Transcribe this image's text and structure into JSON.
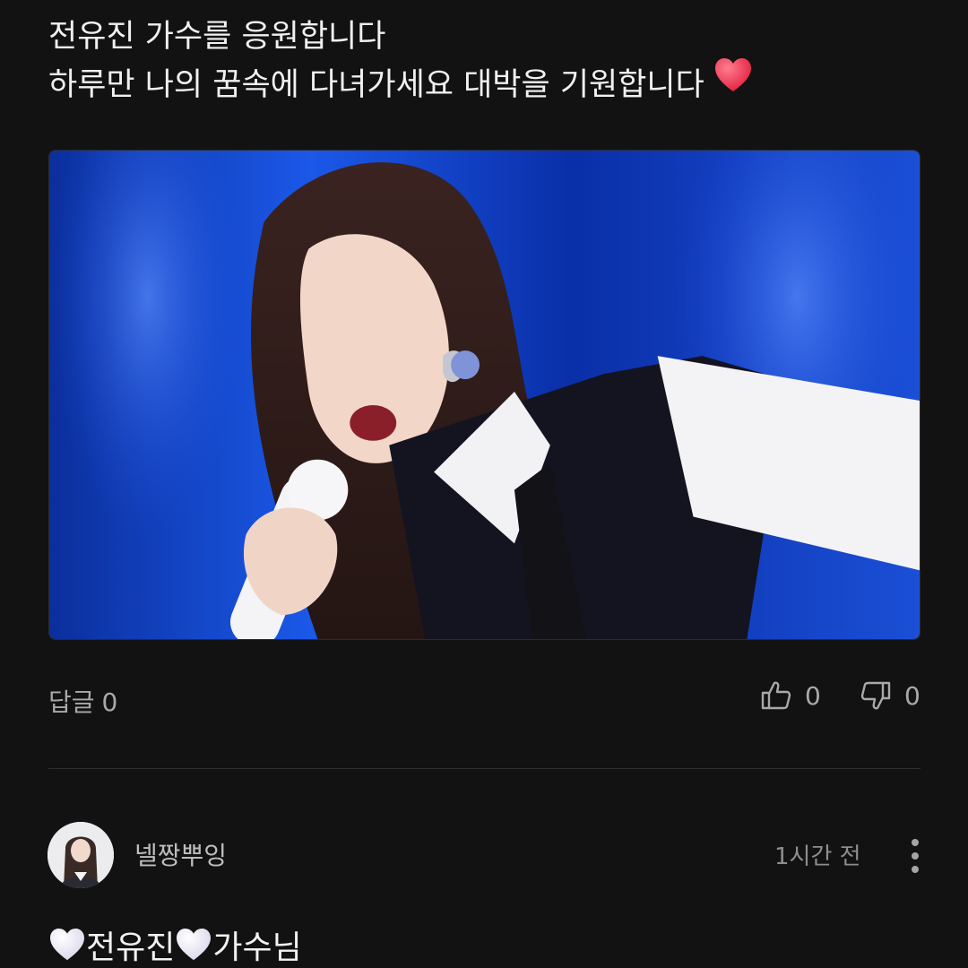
{
  "post": {
    "line1": "전유진 가수를 응원합니다",
    "line2": "하루만 나의 꿈속에 다녀가세요 대박을 기원합니다",
    "heart_color": "#f0304f"
  },
  "actions": {
    "reply_label": "답글",
    "reply_count": "0",
    "like_count": "0",
    "dislike_count": "0"
  },
  "comment": {
    "username": "넬짱뿌잉",
    "time": "1시간 전",
    "part1": "전유진",
    "part2": "가수님"
  },
  "colors": {
    "background": "#121212",
    "image_blue": "#1a4ce0",
    "muted_text": "#a9a9a9"
  },
  "icons": [
    "heart-emoji-icon",
    "thumbs-up-icon",
    "thumbs-down-icon",
    "more-vertical-icon",
    "white-heart-emoji-icon"
  ]
}
